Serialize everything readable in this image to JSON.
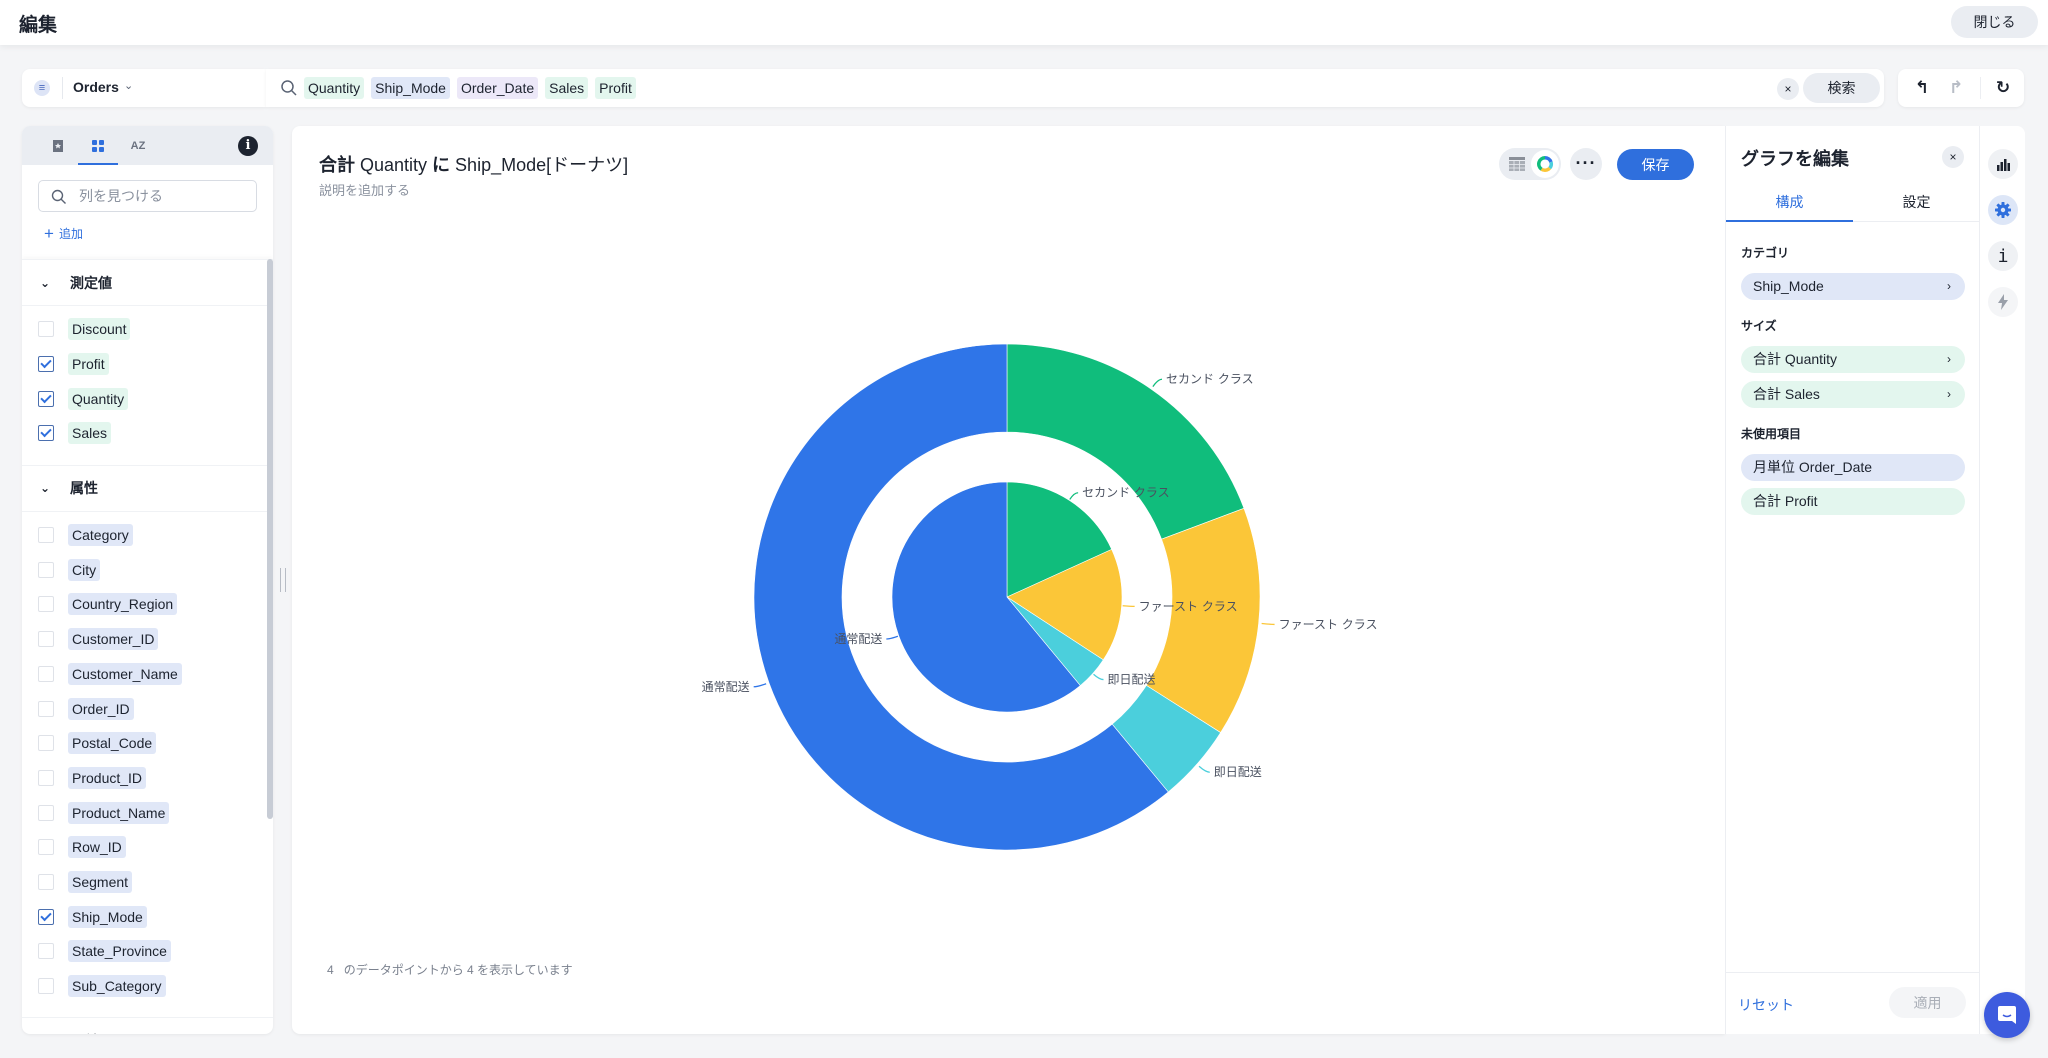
{
  "header": {
    "title": "編集",
    "close_label": "閉じる"
  },
  "source": {
    "name": "Orders",
    "icon": "list-icon"
  },
  "search": {
    "tokens": [
      {
        "label": "Quantity",
        "kind": "measure"
      },
      {
        "label": "Ship_Mode",
        "kind": "attribute"
      },
      {
        "label": "Order_Date",
        "kind": "date"
      },
      {
        "label": "Sales",
        "kind": "measure"
      },
      {
        "label": "Profit",
        "kind": "measure"
      }
    ],
    "clear_icon": "×",
    "search_label": "検索"
  },
  "history": {
    "undo_icon": "↰",
    "redo_icon": "↱",
    "reset_icon": "↻"
  },
  "left_panel": {
    "info_icon": "i",
    "column_search_placeholder": "列を見つける",
    "add_label": "追加",
    "sections": [
      {
        "title": "測定値",
        "kind": "measure",
        "fields": [
          {
            "label": "Discount",
            "checked": false
          },
          {
            "label": "Profit",
            "checked": true
          },
          {
            "label": "Quantity",
            "checked": true
          },
          {
            "label": "Sales",
            "checked": true
          }
        ]
      },
      {
        "title": "属性",
        "kind": "attribute",
        "fields": [
          {
            "label": "Category",
            "checked": false
          },
          {
            "label": "City",
            "checked": false
          },
          {
            "label": "Country_Region",
            "checked": false
          },
          {
            "label": "Customer_ID",
            "checked": false
          },
          {
            "label": "Customer_Name",
            "checked": false
          },
          {
            "label": "Order_ID",
            "checked": false
          },
          {
            "label": "Postal_Code",
            "checked": false
          },
          {
            "label": "Product_ID",
            "checked": false
          },
          {
            "label": "Product_Name",
            "checked": false
          },
          {
            "label": "Row_ID",
            "checked": false
          },
          {
            "label": "Segment",
            "checked": false
          },
          {
            "label": "Ship_Mode",
            "checked": true
          },
          {
            "label": "State_Province",
            "checked": false
          },
          {
            "label": "Sub_Category",
            "checked": false
          }
        ]
      },
      {
        "title": "日付",
        "kind": "date",
        "fields": []
      }
    ]
  },
  "main": {
    "title_bold_1": "合計",
    "title_light_1": " Quantity ",
    "title_bold_2": "に",
    "title_light_2": " Ship_Mode[ドーナツ]",
    "description_placeholder": "説明を追加する",
    "more_icon": "···",
    "save_label": "保存",
    "footer_count": "4",
    "footer_text": "のデータポイントから 4 を表示しています"
  },
  "chart_data": {
    "type": "pie",
    "variant": "nested-donut",
    "title": "合計 Quantity に Ship_Mode[ドーナツ]",
    "categories": [
      "セカンド クラス",
      "ファースト クラス",
      "即日配送",
      "通常配送"
    ],
    "colors": [
      "#10bd7c",
      "#fbc638",
      "#4bcfdc",
      "#2f75e8"
    ],
    "series": [
      {
        "name": "合計 Quantity",
        "ring": "outer",
        "values_percent": [
          19.3,
          14.7,
          5.0,
          61.0
        ]
      },
      {
        "name": "合計 Sales",
        "ring": "inner",
        "values_percent": [
          18.2,
          16.0,
          4.8,
          61.0
        ]
      }
    ],
    "start_angle": "top",
    "direction": "clockwise",
    "legend": "none"
  },
  "edit_panel": {
    "title": "グラフを編集",
    "close_icon": "×",
    "tabs": [
      "構成",
      "設定"
    ],
    "category_label": "カテゴリ",
    "category_items": [
      "Ship_Mode"
    ],
    "size_label": "サイズ",
    "size_items": [
      "合計 Quantity",
      "合計 Sales"
    ],
    "unused_label": "未使用項目",
    "unused_items": [
      {
        "label": "月単位 Order_Date",
        "kind": "attribute"
      },
      {
        "label": "合計 Profit",
        "kind": "measure"
      }
    ],
    "reset_label": "リセット",
    "apply_label": "適用"
  },
  "side_rail": {
    "items": [
      "bar-chart-icon",
      "gear-icon",
      "info-icon",
      "lightning-icon"
    ],
    "info_glyph": "i"
  }
}
